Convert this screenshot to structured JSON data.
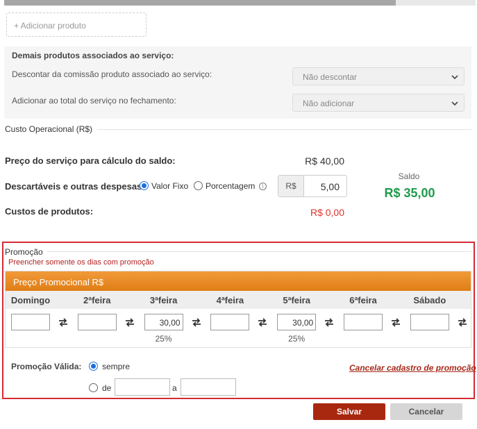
{
  "progress": {
    "fraction": 0.83
  },
  "add_product": {
    "label": "+ Adicionar produto"
  },
  "associated": {
    "title": "Demais produtos associados ao serviço:",
    "discount_label": "Descontar da comissão produto associado ao serviço:",
    "discount_value": "Não descontar",
    "add_label": "Adicionar ao total do serviço no fechamento:",
    "add_value": "Não adicionar"
  },
  "cost": {
    "section_title": "Custo Operacional (R$)",
    "price_label": "Preço do serviço para cálculo do saldo:",
    "price_value": "R$ 40,00",
    "disposables_label": "Descartáveis e outras despesas:",
    "option_fixed": "Valor Fixo",
    "option_percent": "Porcentagem",
    "currency_prefix": "R$",
    "disposables_value": "5,00",
    "products_label": "Custos de produtos:",
    "products_value": "R$ 0,00",
    "saldo_label": "Saldo",
    "saldo_value": "R$ 35,00"
  },
  "promo": {
    "title": "Promoção",
    "subtitle": "Preencher somente os dias com promoção",
    "grid_header": "Preço Promocional R$",
    "days": [
      {
        "label": "Domingo",
        "value": "",
        "pct": ""
      },
      {
        "label": "2ªfeira",
        "value": "",
        "pct": ""
      },
      {
        "label": "3ªfeira",
        "value": "30,00",
        "pct": "25%"
      },
      {
        "label": "4ªfeira",
        "value": "",
        "pct": ""
      },
      {
        "label": "5ªfeira",
        "value": "30,00",
        "pct": "25%"
      },
      {
        "label": "6ªfeira",
        "value": "",
        "pct": ""
      },
      {
        "label": "Sábado",
        "value": "",
        "pct": ""
      }
    ],
    "valid_label": "Promoção Válida:",
    "option_always": "sempre",
    "option_from": "de",
    "to_label": "a",
    "cancel_link": "Cancelar cadastro de promoção"
  },
  "actions": {
    "save": "Salvar",
    "cancel": "Cancelar"
  }
}
